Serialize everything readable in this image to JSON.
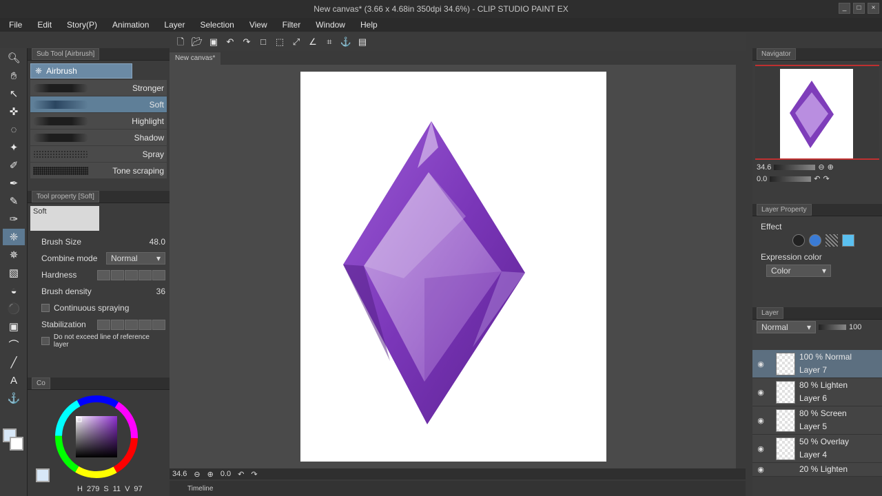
{
  "window": {
    "title": "New canvas* (3.66 x 4.68in 350dpi 34.6%) - CLIP STUDIO PAINT EX",
    "buttons": [
      "_",
      "□",
      "×"
    ]
  },
  "menu": [
    "File",
    "Edit",
    "Story(P)",
    "Animation",
    "Layer",
    "Selection",
    "View",
    "Filter",
    "Window",
    "Help"
  ],
  "subtool": {
    "panel_title": "Sub Tool [Airbrush]",
    "group": "Airbrush",
    "brushes": [
      "Stronger",
      "Soft",
      "Highlight",
      "Shadow",
      "Spray",
      "Tone scraping"
    ],
    "active_index": 1
  },
  "tool_property": {
    "panel_title": "Tool property [Soft]",
    "preview_label": "Soft",
    "brush_size_label": "Brush Size",
    "brush_size": "48.0",
    "combine_label": "Combine mode",
    "combine_value": "Normal",
    "hardness_label": "Hardness",
    "density_label": "Brush density",
    "density_value": "36",
    "continuous_label": "Continuous spraying",
    "stabilization_label": "Stabilization",
    "ref_label": "Do not exceed line of reference layer"
  },
  "color": {
    "panel_tab": "Co",
    "h_label": "H",
    "h": "279",
    "s_label": "S",
    "s": "11",
    "v_label": "V",
    "v": "97"
  },
  "canvas": {
    "tab": "New canvas*",
    "zoom": "34.6",
    "angle": "0.0",
    "timeline": "Timeline"
  },
  "navigator": {
    "title": "Navigator",
    "zoom": "34.6",
    "angle": "0.0"
  },
  "layer_property": {
    "title": "Layer Property",
    "effect_label": "Effect",
    "expression_label": "Expression color",
    "color_value": "Color"
  },
  "layers": {
    "title": "Layer",
    "blend_mode": "Normal",
    "opacity": "100",
    "items": [
      {
        "opacity": "100 %",
        "mode": "Normal",
        "name": "Layer 7"
      },
      {
        "opacity": "80 %",
        "mode": "Lighten",
        "name": "Layer 6"
      },
      {
        "opacity": "80 %",
        "mode": "Screen",
        "name": "Layer 5"
      },
      {
        "opacity": "50 %",
        "mode": "Overlay",
        "name": "Layer 4"
      },
      {
        "opacity": "20 %",
        "mode": "Lighten",
        "name": ""
      }
    ]
  },
  "colors": {
    "gem_dark": "#6a2a9e",
    "gem_mid": "#8e48c6",
    "gem_light": "#b88ad8",
    "active_blue": "#5f7f98"
  }
}
